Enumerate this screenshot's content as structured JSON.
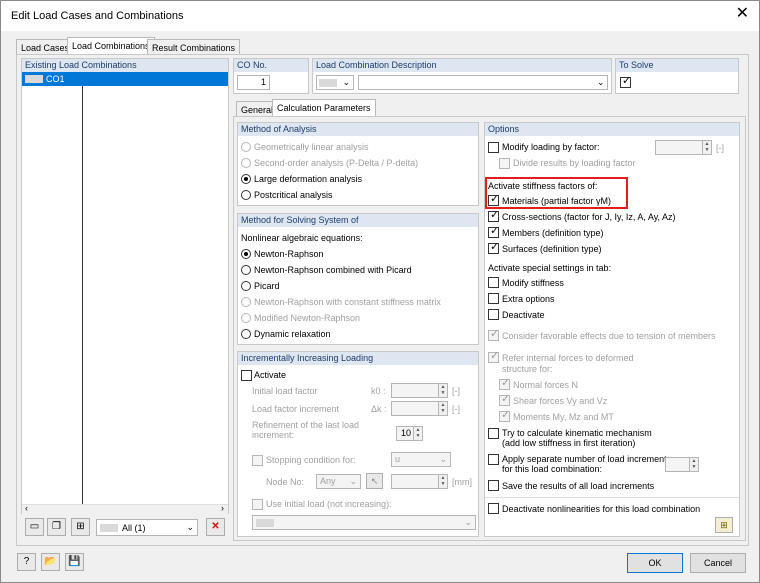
{
  "window": {
    "title": "Edit Load Cases and Combinations",
    "close_glyph": "✕"
  },
  "tabs": [
    {
      "label": "Load Cases"
    },
    {
      "label": "Load Combinations"
    },
    {
      "label": "Result Combinations"
    }
  ],
  "left": {
    "header": "Existing Load Combinations",
    "items": [
      {
        "label": "CO1"
      }
    ],
    "filter_value": "All (1)"
  },
  "co": {
    "header": "CO No.",
    "value": "1"
  },
  "description": {
    "header": "Load Combination Description",
    "value": ""
  },
  "to_solve": {
    "header": "To Solve",
    "checked": true
  },
  "inner_tabs": [
    {
      "label": "General"
    },
    {
      "label": "Calculation Parameters"
    }
  ],
  "method": {
    "header": "Method of Analysis",
    "options": [
      {
        "label": "Geometrically linear analysis",
        "selected": false,
        "enabled": false
      },
      {
        "label": "Second-order analysis (P-Delta / P-delta)",
        "selected": false,
        "enabled": false
      },
      {
        "label": "Large deformation analysis",
        "selected": true,
        "enabled": true
      },
      {
        "label": "Postcritical analysis",
        "selected": false,
        "enabled": true
      }
    ]
  },
  "solving": {
    "header": "Method for Solving System of",
    "sublabel": "Nonlinear algebraic equations:",
    "options": [
      {
        "label": "Newton-Raphson",
        "selected": true,
        "enabled": true
      },
      {
        "label": "Newton-Raphson combined with Picard",
        "selected": false,
        "enabled": true
      },
      {
        "label": "Picard",
        "selected": false,
        "enabled": true
      },
      {
        "label": "Newton-Raphson with constant stiffness matrix",
        "selected": false,
        "enabled": false
      },
      {
        "label": "Modified Newton-Raphson",
        "selected": false,
        "enabled": false
      },
      {
        "label": "Dynamic relaxation",
        "selected": false,
        "enabled": true
      }
    ]
  },
  "incr": {
    "header": "Incrementally Increasing Loading",
    "activate": "Activate",
    "initial_factor": "Initial load factor",
    "initial_symbol": "k0 :",
    "increment": "Load factor increment",
    "increment_symbol": "Δk :",
    "refinement": "Refinement of the last load increment:",
    "refinement_value": "10",
    "stopping": "Stopping condition for:",
    "stopping_value": "u",
    "node_no": "Node No:",
    "node_value": "Any",
    "unit_dash": "[-]",
    "unit_mm": "[mm]",
    "initial_load": "Use initial load (not increasing):"
  },
  "options": {
    "header": "Options",
    "modify_loading": "Modify loading by factor:",
    "modify_unit": "[-]",
    "divide": "Divide results by loading factor",
    "activate_stiffness": "Activate stiffness factors of:",
    "materials": "Materials (partial factor γM)",
    "cross_sections": "Cross-sections (factor for J, Iy, Iz, A, Ay, Az)",
    "members": "Members (definition type)",
    "surfaces": "Surfaces (definition type)",
    "special": "Activate special settings in tab:",
    "modify_stiffness": "Modify stiffness",
    "extra_options": "Extra options",
    "deactivate": "Deactivate",
    "favorable": "Consider favorable effects due to tension of members",
    "refer1": "Refer internal forces to deformed",
    "refer2": "structure for:",
    "normal": "Normal forces N",
    "shear": "Shear forces Vy and Vz",
    "moments": "Moments My, Mz and MT",
    "kinematic1": "Try to calculate kinematic mechanism",
    "kinematic2": "(add low stiffness in first iteration)",
    "separate1": "Apply separate number of load increments",
    "separate2": "for this load combination:",
    "save_results": "Save the results of all load increments",
    "deactivate_nonlin": "Deactivate nonlinearities for this load combination"
  },
  "buttons": {
    "ok": "OK",
    "cancel": "Cancel"
  },
  "check_glyph": "✓"
}
